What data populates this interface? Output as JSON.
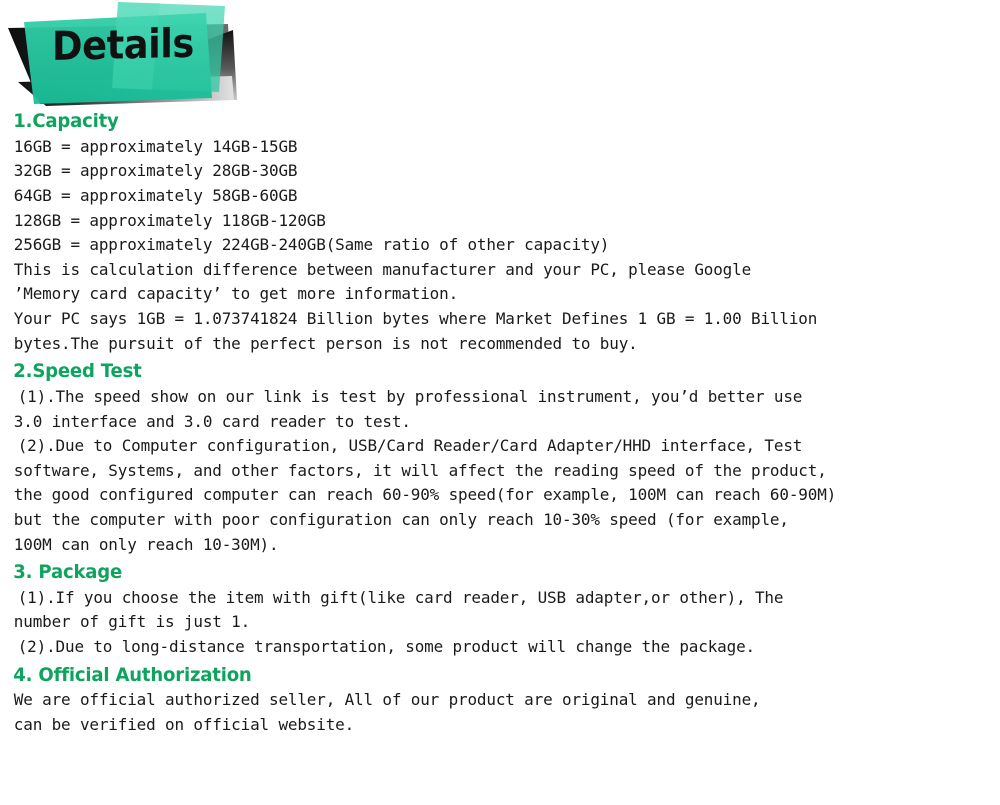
{
  "banner": {
    "title": "Details",
    "colors": {
      "green": "#2BC9A5",
      "green_light": "#3FD3B0",
      "dark": "#1a1a1a",
      "heading_green": "#0FA45E"
    }
  },
  "sections": [
    {
      "heading": "1.Capacity",
      "lines": [
        "16GB = approximately 14GB-15GB",
        "32GB = approximately 28GB-30GB",
        "64GB = approximately 58GB-60GB",
        "128GB = approximately 118GB-120GB",
        "256GB = approximately 224GB-240GB(Same ratio of other capacity)",
        "This is calculation difference between manufacturer and your PC, please Google",
        "’Memory card capacity’ to get more information.",
        "Your PC says 1GB = 1.073741824 Billion bytes where Market Defines 1 GB = 1.00 Billion",
        "bytes.The pursuit of the perfect person is not recommended to buy."
      ]
    },
    {
      "heading": "2.Speed Test",
      "lines": [
        "(1).The speed show on our link is test by professional instrument, you’d better use",
        "3.0 interface and 3.0 card reader to test.",
        "(2).Due to Computer configuration, USB/Card Reader/Card Adapter/HHD interface, Test",
        "software, Systems, and other factors, it will affect the reading speed of the product,",
        "the good configured computer can reach 60-90% speed(for example, 100M can reach 60-90M)",
        "but the computer with poor configuration can only reach 10-30% speed (for example,",
        "100M can only reach 10-30M)."
      ]
    },
    {
      "heading": "3. Package",
      "lines": [
        "(1).If you choose the item with gift(like card reader, USB adapter,or other), The",
        "number of gift is just 1.",
        "(2).Due to long-distance transportation, some product will change the package."
      ]
    },
    {
      "heading": "4. Official Authorization",
      "lines": [
        "We are official authorized seller, All of our product are original and genuine,",
        "can be verified on official website."
      ]
    }
  ]
}
